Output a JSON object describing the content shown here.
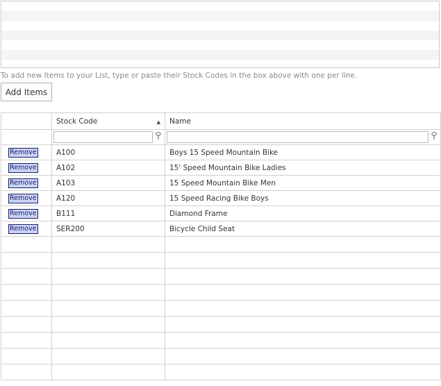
{
  "paste_box": {
    "value": ""
  },
  "hint_text": "To add new Items to your List, type or paste their Stock Codes in the box above with one per line.",
  "add_button_label": "Add Items",
  "table": {
    "columns": [
      "",
      "Stock Code",
      "Name"
    ],
    "sorted_column": "Stock Code",
    "sort_direction": "ascending",
    "filters": {
      "stock_code": "",
      "name": ""
    },
    "rows": [
      {
        "action": "Remove",
        "stock_code": "A100",
        "name": "Boys 15 Speed Mountain Bike"
      },
      {
        "action": "Remove",
        "stock_code": "A102",
        "name": "15' Speed Mountain Bike Ladies"
      },
      {
        "action": "Remove",
        "stock_code": "A103",
        "name": "15 Speed Mountain Bike Men"
      },
      {
        "action": "Remove",
        "stock_code": "A120",
        "name": "15 Speed Racing Bike Boys"
      },
      {
        "action": "Remove",
        "stock_code": "B111",
        "name": "Diamond Frame"
      },
      {
        "action": "Remove",
        "stock_code": "SER200",
        "name": "Bicycle Child Seat"
      }
    ]
  },
  "colors": {
    "border": "#d0d0d0",
    "remove_bg": "#c9d4f5",
    "remove_text": "#1a1a66",
    "hint": "#8a8a8a"
  }
}
